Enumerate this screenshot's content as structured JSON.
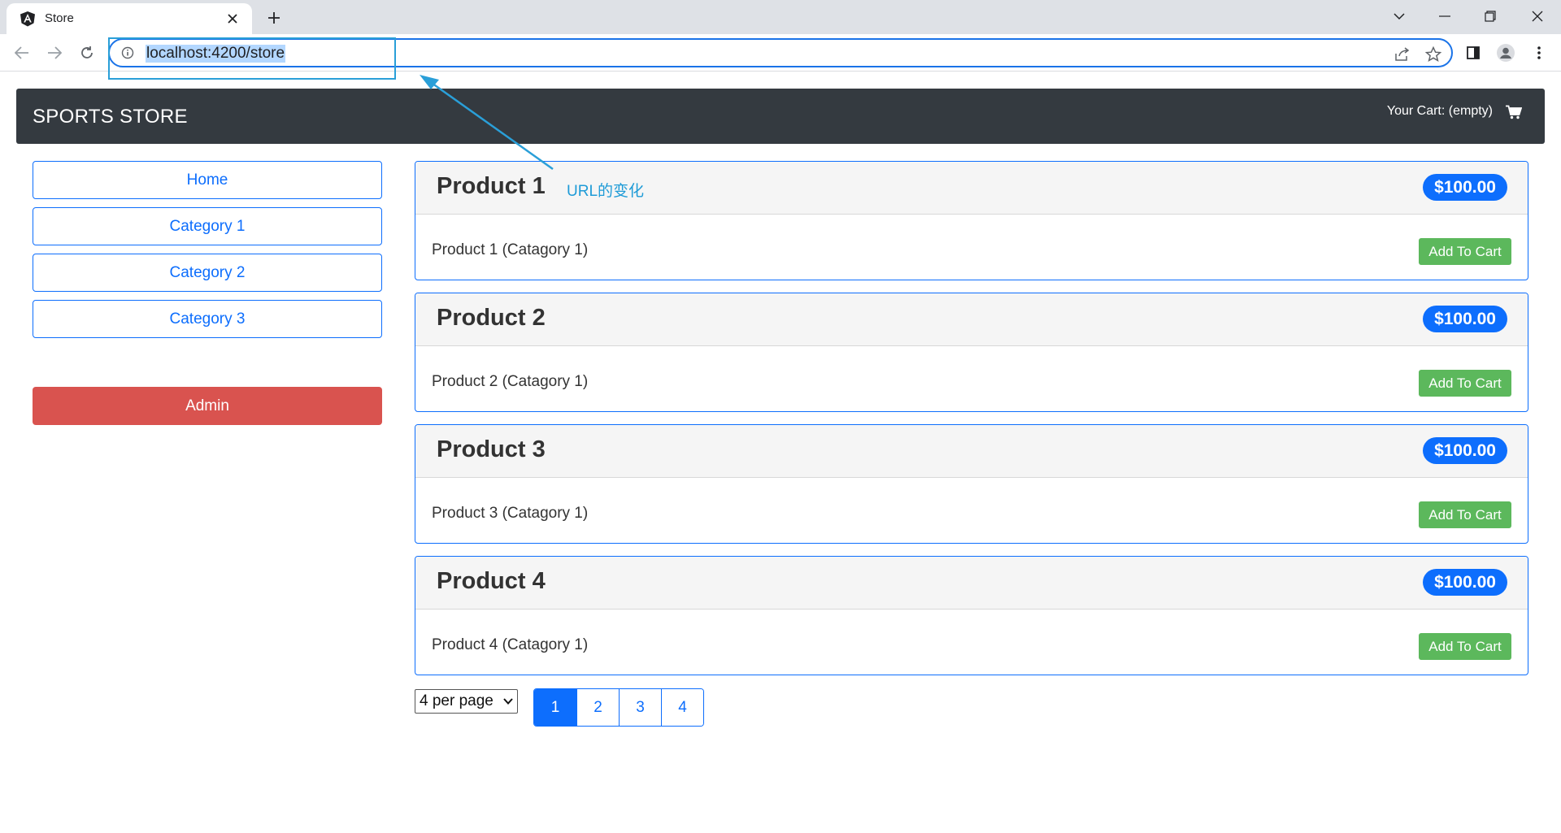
{
  "browser": {
    "tab_title": "Store",
    "url": "localhost:4200/store"
  },
  "annotation": {
    "label": "URL的变化"
  },
  "navbar": {
    "brand": "SPORTS STORE",
    "cart_summary": "Your Cart: (empty)"
  },
  "sidebar": {
    "items": [
      {
        "label": "Home"
      },
      {
        "label": "Category 1"
      },
      {
        "label": "Category 2"
      },
      {
        "label": "Category 3"
      }
    ],
    "admin_label": "Admin"
  },
  "products": [
    {
      "name": "Product 1",
      "price": "$100.00",
      "description": "Product 1 (Catagory 1)",
      "button": "Add To Cart"
    },
    {
      "name": "Product 2",
      "price": "$100.00",
      "description": "Product 2 (Catagory 1)",
      "button": "Add To Cart"
    },
    {
      "name": "Product 3",
      "price": "$100.00",
      "description": "Product 3 (Catagory 1)",
      "button": "Add To Cart"
    },
    {
      "name": "Product 4",
      "price": "$100.00",
      "description": "Product 4 (Catagory 1)",
      "button": "Add To Cart"
    }
  ],
  "footer": {
    "per_page": "4 per page",
    "pages": [
      "1",
      "2",
      "3",
      "4"
    ],
    "active_page": "1"
  },
  "colors": {
    "primary": "#0d6efd",
    "navbar": "#343a40",
    "success": "#5cb85c",
    "danger": "#d9534f",
    "annotation": "#2a9fd8"
  }
}
